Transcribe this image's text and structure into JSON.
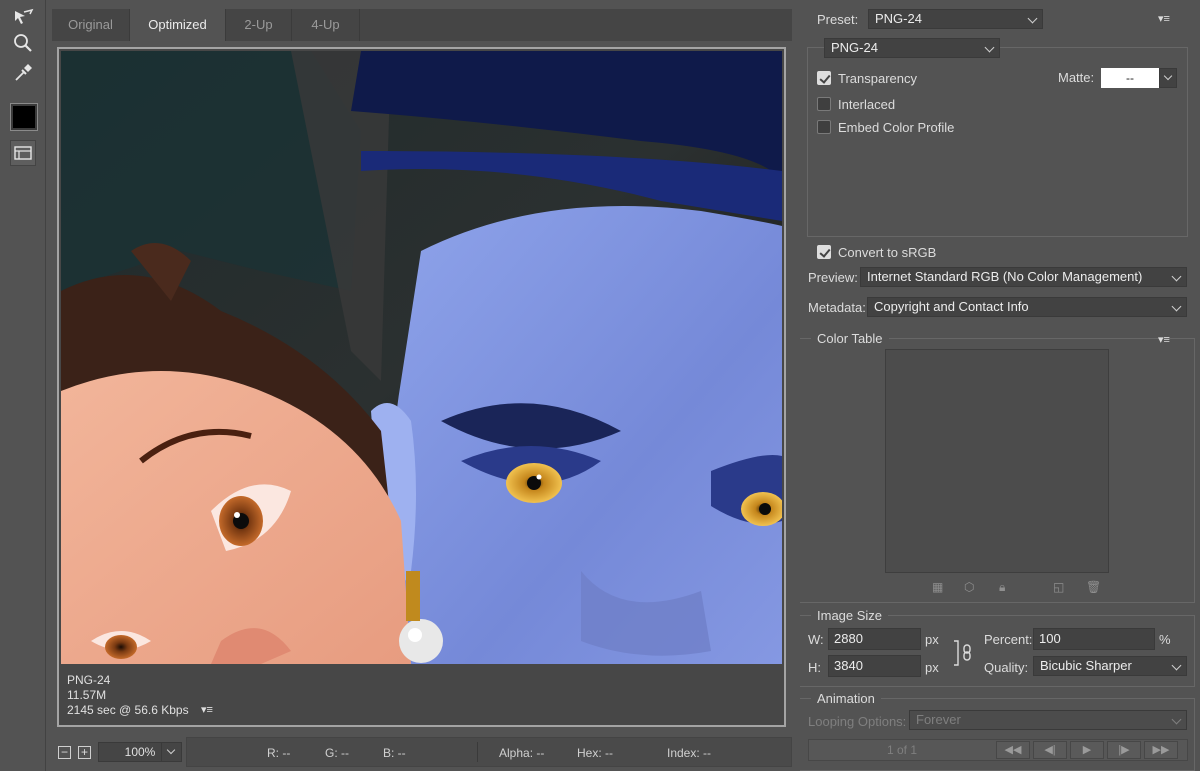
{
  "tools": {
    "slice_select": "slice-select-icon",
    "zoom": "zoom-icon",
    "eyedropper": "eyedropper-icon",
    "color_swatch": "#000000",
    "toggle_slices": "toggle-slices-icon"
  },
  "tabs": [
    {
      "label": "Original"
    },
    {
      "label": "Optimized"
    },
    {
      "label": "2-Up"
    },
    {
      "label": "4-Up"
    }
  ],
  "canvas_info": {
    "format": "PNG-24",
    "size": "11.57M",
    "download_time": "2145 sec @ 56.6 Kbps"
  },
  "status_bar": {
    "zoom_value": "100%",
    "r": "R: --",
    "g": "G: --",
    "b": "B: --",
    "alpha": "Alpha: --",
    "hex": "Hex: --",
    "index": "Index: --"
  },
  "settings": {
    "preset_label": "Preset:",
    "preset_value": "PNG-24",
    "format_value": "PNG-24",
    "transparency_label": "Transparency",
    "transparency_checked": true,
    "matte_label": "Matte:",
    "matte_value": "--",
    "interlaced_label": "Interlaced",
    "interlaced_checked": false,
    "embed_label": "Embed Color Profile",
    "embed_checked": false,
    "convert_label": "Convert to sRGB",
    "convert_checked": true,
    "preview_label": "Preview:",
    "preview_value": "Internet Standard RGB (No Color Management)",
    "metadata_label": "Metadata:",
    "metadata_value": "Copyright and Contact Info"
  },
  "color_table": {
    "title": "Color Table"
  },
  "image_size": {
    "title": "Image Size",
    "w_label": "W:",
    "w_value": "2880",
    "h_label": "H:",
    "h_value": "3840",
    "unit": "px",
    "percent_label": "Percent:",
    "percent_value": "100",
    "percent_unit": "%",
    "quality_label": "Quality:",
    "quality_value": "Bicubic Sharper"
  },
  "animation": {
    "title": "Animation",
    "looping_label": "Looping Options:",
    "looping_value": "Forever",
    "frame_counter": "1 of 1"
  },
  "colors": {
    "panel_bg": "#535353",
    "field_bg": "#424242",
    "accent_white": "#ffffff"
  }
}
